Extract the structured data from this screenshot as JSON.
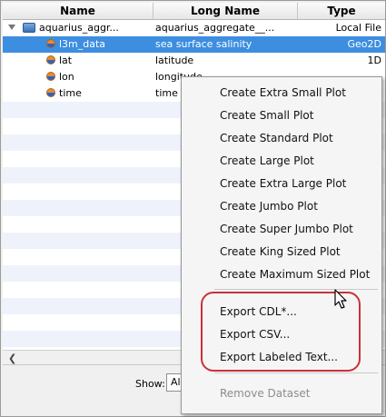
{
  "table": {
    "columns": {
      "name": "Name",
      "long_name": "Long Name",
      "type": "Type"
    },
    "rows": [
      {
        "name": "aquarius_aggr...",
        "long_name": "aquarius_aggregate__...",
        "type": "Local File"
      },
      {
        "name": "l3m_data",
        "long_name": "sea surface salinity",
        "type": "Geo2D"
      },
      {
        "name": "lat",
        "long_name": "latitude",
        "type": "1D"
      },
      {
        "name": "lon",
        "long_name": "longitude",
        "type": ""
      },
      {
        "name": "time",
        "long_name": "time",
        "type": ""
      }
    ]
  },
  "bottom_bar": {
    "show_label": "Show:",
    "show_value": "Al"
  },
  "context_menu": {
    "items": [
      "Create Extra Small Plot",
      "Create Small Plot",
      "Create Standard Plot",
      "Create Large Plot",
      "Create Extra Large Plot",
      "Create Jumbo Plot",
      "Create Super Jumbo Plot",
      "Create King Sized Plot",
      "Create Maximum Sized Plot",
      "Export CDL*...",
      "Export CSV...",
      "Export Labeled Text...",
      "Remove Dataset"
    ]
  },
  "colors": {
    "selection": "#3d8ee0",
    "highlight_ring": "#c8323a"
  },
  "icons": {
    "tree": "chevron-down-icon",
    "dataset": "folder-icon",
    "variable": "variable-icon",
    "cursor": "cursor-icon"
  }
}
